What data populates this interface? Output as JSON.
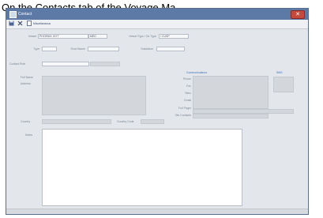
{
  "caption": "On the Contacts tab of the Voyage Ma",
  "window": {
    "title": "Contact",
    "close_glyph": "✕"
  },
  "toolbar": {
    "save_icon": "floppy-disk-icon",
    "delete_icon": "delete-x-icon",
    "open_icon": "document-icon",
    "link_label": "Miscellaneous"
  },
  "form": {
    "vessel_label": "Vessel",
    "vessel_value": "PHOENIX 2077",
    "vessel_code": "MED",
    "vessel_type_label": "Vessel Type / Dir Type",
    "vessel_type_value": "/ CUSP",
    "type_label": "Type",
    "short_name_label": "Short Name",
    "salutation_label": "Salutation",
    "contact_role_label": "Contact Role",
    "full_name_label": "Full Name",
    "address_label": "Address",
    "country_label": "Country",
    "country_code_label": "Country Code",
    "communications_label": "Communications",
    "sms_label": "SMS",
    "phone_label": "Phone",
    "fax_label": "Fax",
    "telex_label": "Telex",
    "email_label": "Email",
    "pager_label": "Full Pager",
    "other_contacts_label": "Oth Contacts",
    "notes_label": "Notes"
  }
}
